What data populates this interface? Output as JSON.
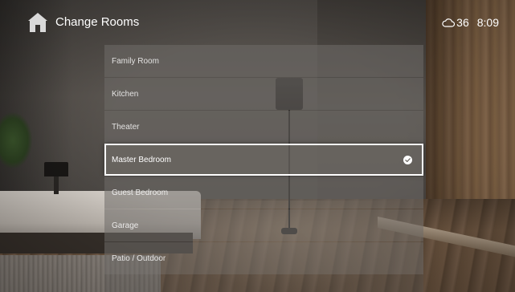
{
  "header": {
    "title": "Change Rooms",
    "home_icon": "home-icon",
    "weather_icon": "cloud-icon",
    "temperature": "36",
    "time": "8:09"
  },
  "rooms": {
    "items": [
      {
        "label": "Family Room",
        "selected": false
      },
      {
        "label": "Kitchen",
        "selected": false
      },
      {
        "label": "Theater",
        "selected": false
      },
      {
        "label": "Master Bedroom",
        "selected": true
      },
      {
        "label": "Guest Bedroom",
        "selected": false
      },
      {
        "label": "Garage",
        "selected": false
      },
      {
        "label": "Patio / Outdoor",
        "selected": false
      }
    ],
    "selected_icon": "check-circle-icon"
  },
  "colors": {
    "text": "#ffffff",
    "selection_border": "#ffffff",
    "icon_fill": "#d9d9d9"
  }
}
